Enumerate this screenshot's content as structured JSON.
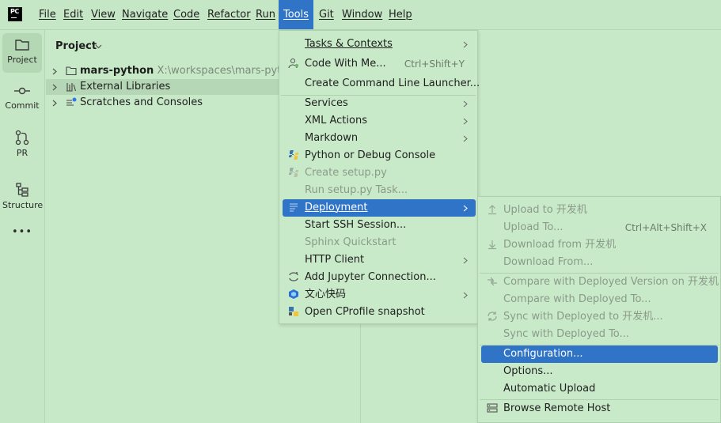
{
  "menubar": {
    "items": [
      "File",
      "Edit",
      "View",
      "Navigate",
      "Code",
      "Refactor",
      "Run",
      "Tools",
      "Git",
      "Window",
      "Help"
    ],
    "active": "Tools"
  },
  "app_logo": "PC",
  "toolstrip": {
    "items": [
      {
        "label": "Project",
        "icon": "folder-icon"
      },
      {
        "label": "Commit",
        "icon": "commit-icon"
      },
      {
        "label": "PR",
        "icon": "pull-request-icon"
      },
      {
        "label": "Structure",
        "icon": "structure-icon"
      },
      {
        "label": "•••",
        "icon": "more-icon"
      }
    ]
  },
  "project": {
    "header": "Project",
    "tree": [
      {
        "name": "mars-python",
        "path": "X:\\workspaces\\mars-python",
        "icon": "folder-icon"
      },
      {
        "name": "External Libraries",
        "icon": "library-icon"
      },
      {
        "name": "Scratches and Consoles",
        "icon": "scratches-icon"
      }
    ]
  },
  "tools_menu": {
    "items": [
      {
        "label": "Tasks & Contexts",
        "submenu": true
      },
      {
        "label": "Code With Me...",
        "shortcut": "Ctrl+Shift+Y",
        "icon": "code-with-me-icon"
      },
      {
        "label": "Create Command Line Launcher..."
      },
      {
        "label": "Services",
        "submenu": true
      },
      {
        "label": "XML Actions",
        "submenu": true
      },
      {
        "label": "Markdown",
        "submenu": true
      },
      {
        "label": "Python or Debug Console",
        "icon": "python-icon"
      },
      {
        "label": "Create setup.py",
        "disabled": true,
        "icon": "python-icon"
      },
      {
        "label": "Run setup.py Task...",
        "disabled": true
      },
      {
        "label": "Deployment",
        "submenu": true,
        "selected": true,
        "icon": "deployment-icon"
      },
      {
        "label": "Start SSH Session..."
      },
      {
        "label": "Sphinx Quickstart",
        "disabled": true
      },
      {
        "label": "HTTP Client",
        "submenu": true
      },
      {
        "label": "Add Jupyter Connection...",
        "icon": "jupyter-icon"
      },
      {
        "label": "文心快码",
        "submenu": true,
        "icon": "baidu-comate-icon"
      },
      {
        "label": "Open CProfile snapshot",
        "icon": "python-profile-icon"
      }
    ]
  },
  "deploy_menu": {
    "items": [
      {
        "label": "Upload to 开发机",
        "disabled": true,
        "icon": "upload-icon"
      },
      {
        "label": "Upload To...",
        "shortcut": "Ctrl+Alt+Shift+X",
        "disabled": true
      },
      {
        "label": "Download from 开发机",
        "disabled": true,
        "icon": "download-icon"
      },
      {
        "label": "Download From...",
        "disabled": true
      },
      {
        "label": "Compare with Deployed Version on 开发机",
        "disabled": true,
        "icon": "compare-icon"
      },
      {
        "label": "Compare with Deployed To...",
        "disabled": true
      },
      {
        "label": "Sync with Deployed to 开发机...",
        "disabled": true,
        "icon": "sync-icon"
      },
      {
        "label": "Sync with Deployed To...",
        "disabled": true
      },
      {
        "label": "Configuration...",
        "selected": true
      },
      {
        "label": "Options..."
      },
      {
        "label": "Automatic Upload"
      },
      {
        "label": "Browse Remote Host",
        "icon": "remote-host-icon"
      }
    ]
  },
  "colors": {
    "background": "#c7e9c7",
    "selection": "#2f74c7",
    "disabled_text": "#8a9a8a"
  }
}
